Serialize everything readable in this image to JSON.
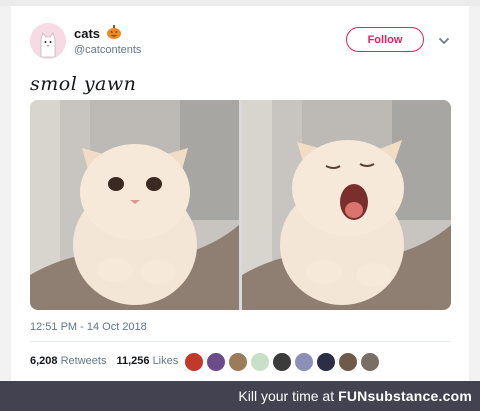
{
  "user": {
    "display_name": "cats",
    "handle": "@catcontents",
    "avatar_icon": "cat-avatar-icon",
    "emoji_icon": "jack-o-lantern-icon"
  },
  "actions": {
    "follow_label": "Follow",
    "more_icon": "chevron-down-icon"
  },
  "tweet": {
    "text": "smol yawn",
    "timestamp": "12:51 PM - 14 Oct 2018",
    "media": [
      {
        "description_icon": "cat-photo"
      },
      {
        "description_icon": "cat-yawning-photo"
      }
    ]
  },
  "stats": {
    "retweets_count": "6,208",
    "retweets_label": "Retweets",
    "likes_count": "11,256",
    "likes_label": "Likes"
  },
  "likers": [
    {
      "color": "#c0392b"
    },
    {
      "color": "#6b4b8a"
    },
    {
      "color": "#9a7b5a"
    },
    {
      "color": "#c9e0c8"
    },
    {
      "color": "#3b3b3b"
    },
    {
      "color": "#8e8fb6"
    },
    {
      "color": "#2c2f44"
    },
    {
      "color": "#6e5a4a"
    },
    {
      "color": "#7a6f66"
    }
  ],
  "footer": {
    "text": "Kill your time at",
    "brand": "FUNsubstance.com"
  },
  "colors": {
    "accent": "#e0245e",
    "footer_bg": "#424250"
  }
}
